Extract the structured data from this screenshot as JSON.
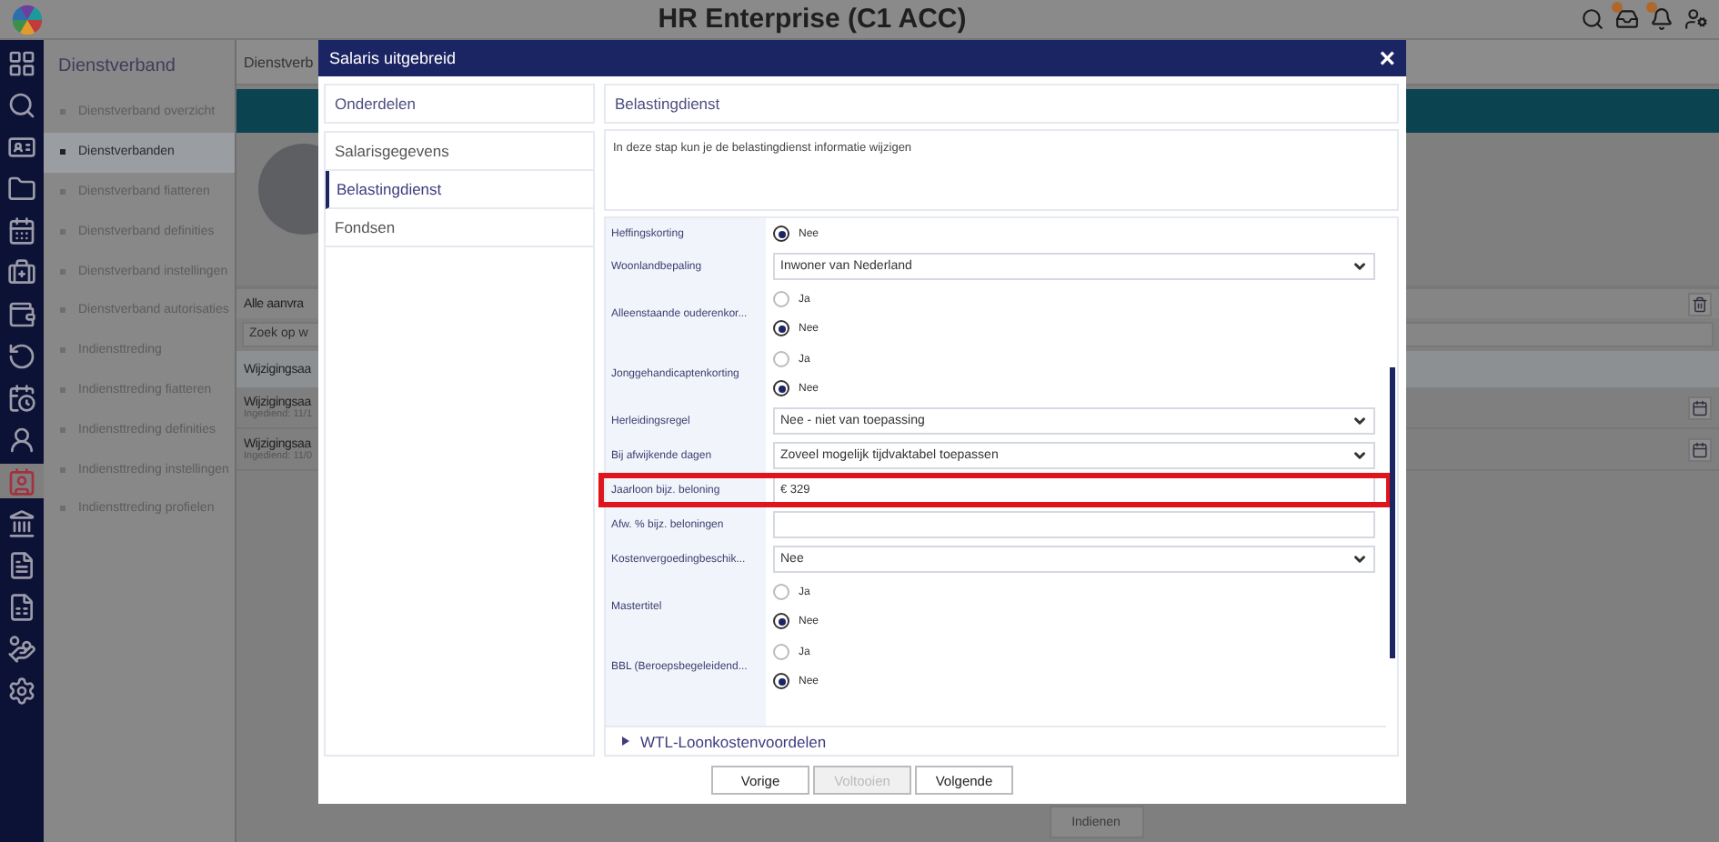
{
  "app": {
    "title": "HR Enterprise (C1 ACC)"
  },
  "rail": [
    {
      "selected": false
    },
    {
      "selected": false
    },
    {
      "selected": false
    },
    {
      "selected": false
    },
    {
      "selected": false
    },
    {
      "selected": false
    },
    {
      "selected": false
    },
    {
      "selected": false
    },
    {
      "selected": false
    },
    {
      "selected": false
    },
    {
      "selected": true
    },
    {
      "selected": false
    },
    {
      "selected": false
    },
    {
      "selected": false
    },
    {
      "selected": false
    },
    {
      "selected": false
    }
  ],
  "nav": {
    "title": "Dienstverband",
    "items": [
      {
        "label": "Dienstverband overzicht",
        "selected": false
      },
      {
        "label": "Dienstverbanden",
        "selected": true
      },
      {
        "label": "Dienstverband fiatteren",
        "selected": false
      },
      {
        "label": "Dienstverband definities",
        "selected": false
      },
      {
        "label": "Dienstverband instellingen",
        "selected": false
      },
      {
        "label": "Dienstverband autorisaties",
        "selected": false
      },
      {
        "label": "Indiensttreding",
        "selected": false
      },
      {
        "label": "Indiensttreding fiatteren",
        "selected": false
      },
      {
        "label": "Indiensttreding definities",
        "selected": false
      },
      {
        "label": "Indiensttreding instellingen",
        "selected": false
      },
      {
        "label": "Indiensttreding profielen",
        "selected": false
      }
    ]
  },
  "background": {
    "header": "Dienstverb",
    "list_title": "Alle aanvra",
    "search_placeholder": "Zoek op w",
    "group": "Wijzigingsaa",
    "rows": [
      {
        "title": "Wijzigingsaa",
        "meta": "Ingediend: 11/1"
      },
      {
        "title": "Wijzigingsaa",
        "meta": "Ingediend: 11/0"
      }
    ],
    "submit": "Indienen"
  },
  "dialog": {
    "title": "Salaris uitgebreid",
    "close": "×",
    "steps_title": "Onderdelen",
    "steps": [
      {
        "label": "Salarisgegevens",
        "selected": false
      },
      {
        "label": "Belastingdienst",
        "selected": true
      },
      {
        "label": "Fondsen",
        "selected": false
      }
    ],
    "section_title": "Belastingdienst",
    "description": "In deze stap kun je de belastingdienst informatie wijzigen",
    "fields": [
      {
        "kind": "radio",
        "label": "Heffingskorting",
        "highlighted": false,
        "options": [
          {
            "label": "Nee",
            "selected": true
          }
        ]
      },
      {
        "kind": "select",
        "label": "Woonlandbepaling",
        "highlighted": false,
        "value": "Inwoner van Nederland"
      },
      {
        "kind": "radio",
        "label": "Alleenstaande ouderenkor...",
        "highlighted": false,
        "options": [
          {
            "label": "Ja",
            "selected": false
          },
          {
            "label": "Nee",
            "selected": true
          }
        ]
      },
      {
        "kind": "radio",
        "label": "Jonggehandicaptenkorting",
        "highlighted": false,
        "options": [
          {
            "label": "Ja",
            "selected": false
          },
          {
            "label": "Nee",
            "selected": true
          }
        ]
      },
      {
        "kind": "select",
        "label": "Herleidingsregel",
        "highlighted": false,
        "value": "Nee - niet van toepassing"
      },
      {
        "kind": "select",
        "label": "Bij afwijkende dagen",
        "highlighted": false,
        "value": "Zoveel mogelijk tijdvaktabel toepassen"
      },
      {
        "kind": "input",
        "label": "Jaarloon bijz. beloning",
        "highlighted": true,
        "value": "€ 329"
      },
      {
        "kind": "input",
        "label": "Afw. % bijz. beloningen",
        "highlighted": false
      },
      {
        "kind": "select",
        "label": "Kostenvergoedingbeschik...",
        "highlighted": false,
        "value": "Nee"
      },
      {
        "kind": "radio",
        "label": "Mastertitel",
        "highlighted": false,
        "options": [
          {
            "label": "Ja",
            "selected": false
          },
          {
            "label": "Nee",
            "selected": true
          }
        ]
      },
      {
        "kind": "radio",
        "label": "BBL (Beroepsbegeleidend...",
        "highlighted": false,
        "options": [
          {
            "label": "Ja",
            "selected": false
          },
          {
            "label": "Nee",
            "selected": true
          }
        ]
      }
    ],
    "subsection": {
      "label": "WTL-Loonkostenvoordelen",
      "expanded": false
    },
    "buttons": [
      {
        "label": "Vorige",
        "disabled": false
      },
      {
        "label": "Voltooien",
        "disabled": true
      },
      {
        "label": "Volgende",
        "disabled": false
      }
    ]
  }
}
